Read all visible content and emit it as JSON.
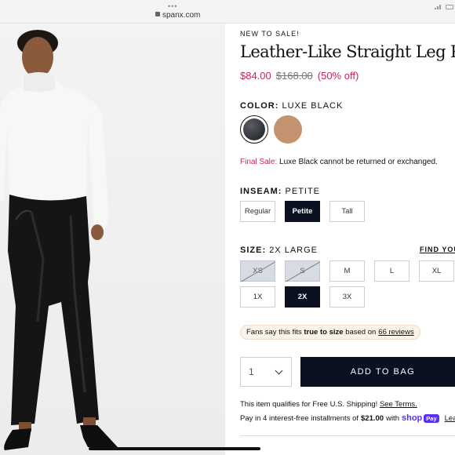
{
  "browser": {
    "dots": "•••",
    "url": "spanx.com"
  },
  "product": {
    "eyebrow": "NEW TO SALE!",
    "title": "Leather-Like Straight Leg Pant",
    "price_sale": "$84.00",
    "price_original": "$168.00",
    "discount": "(50% off)"
  },
  "color": {
    "label": "COLOR:",
    "selected": "LUXE BLACK",
    "swatches": [
      {
        "name": "Luxe Black",
        "hex": "#3a3d42",
        "selected": true
      },
      {
        "name": "Tan",
        "hex": "#c2936e",
        "selected": false
      }
    ]
  },
  "final_sale": {
    "label": "Final Sale:",
    "text": "Luxe Black cannot be returned or exchanged."
  },
  "inseam": {
    "label": "INSEAM:",
    "selected": "PETITE",
    "options": [
      "Regular",
      "Petite",
      "Tall"
    ]
  },
  "size": {
    "label": "SIZE:",
    "selected": "2X LARGE",
    "find_link": "FIND YOUR",
    "options": [
      "XS",
      "S",
      "M",
      "L",
      "XL",
      "1X",
      "2X",
      "3X"
    ]
  },
  "fans": {
    "prefix": "Fans say this fits",
    "bold": "true to size",
    "middle": "based on",
    "link": "66 reviews"
  },
  "cart": {
    "quantity": "1",
    "add_to_bag": "ADD TO BAG"
  },
  "shipping": {
    "text": "This item qualifies for Free U.S. Shipping!",
    "link": "See Terms."
  },
  "payment": {
    "prefix": "Pay in 4 interest-free installments of",
    "amount": "$21.00",
    "with": "with",
    "brand": "shop",
    "pill": "Pay",
    "learn": "Learn m"
  },
  "colors": {
    "accent_red": "#c8255a",
    "button_navy": "#0b1121"
  }
}
